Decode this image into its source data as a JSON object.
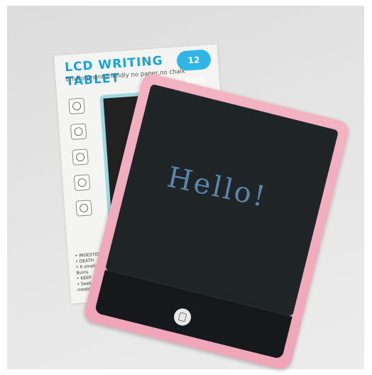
{
  "box": {
    "title": "LCD WRITING TABLET",
    "subtitle": "Environment-friendly no paper,no chalk",
    "size_badge": "12 inch",
    "warnings": [
      "• INGESTION !",
      "• DEATH",
      "• A small",
      "Burns",
      "• KEEP",
      "• Seek",
      "medical"
    ],
    "screen_color": "#222222",
    "accent_color": "#1aa3d6"
  },
  "tablet": {
    "screen_text": "Hello!",
    "body_color": "#eea6b8",
    "screen_color": "#1f2427",
    "ink_color": "#6ea6d8"
  }
}
